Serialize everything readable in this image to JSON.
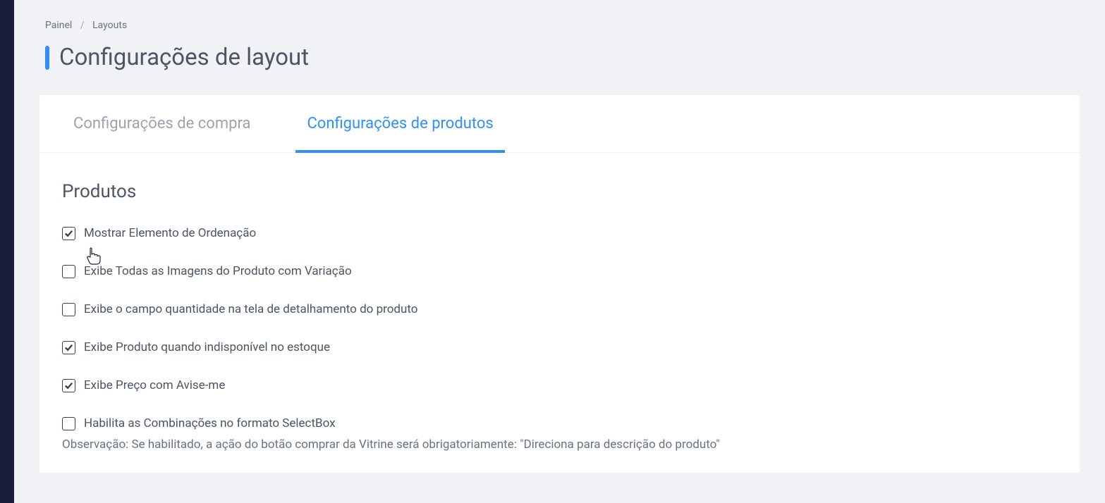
{
  "breadcrumb": {
    "root": "Painel",
    "current": "Layouts"
  },
  "page_title": "Configurações de layout",
  "tabs": [
    {
      "label": "Configurações de compra",
      "active": false
    },
    {
      "label": "Configurações de produtos",
      "active": true
    }
  ],
  "section": {
    "title": "Produtos",
    "options": [
      {
        "label": "Mostrar Elemento de Ordenação",
        "checked": true
      },
      {
        "label": "Exibe Todas as Imagens do Produto com Variação",
        "checked": false
      },
      {
        "label": "Exibe o campo quantidade na tela de detalhamento do produto",
        "checked": false
      },
      {
        "label": "Exibe Produto quando indisponível no estoque",
        "checked": true
      },
      {
        "label": "Exibe Preço com Avise-me",
        "checked": true
      },
      {
        "label": "Habilita as Combinações no formato SelectBox",
        "checked": false
      }
    ],
    "note": "Observação: Se habilitado, a ação do botão comprar da Vitrine será obrigatoriamente: \"Direciona para descrição do produto\""
  }
}
